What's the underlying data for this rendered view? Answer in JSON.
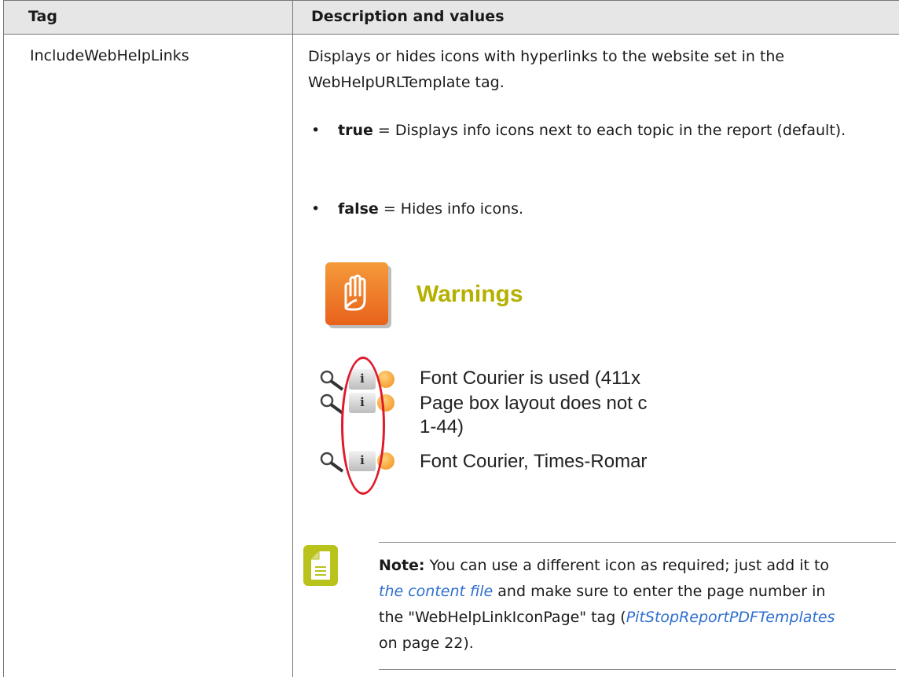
{
  "table": {
    "header": {
      "tag": "Tag",
      "description": "Description and values"
    },
    "row": {
      "tag": "IncludeWebHelpLinks",
      "description": "Displays or hides icons with hyperlinks to the website set in the WebHelpURLTemplate tag.",
      "bullets": [
        {
          "term": "true",
          "text": " = Displays info icons next to each topic in the report (default)."
        },
        {
          "term": "false",
          "text": " = Hides info icons."
        }
      ]
    }
  },
  "illustration": {
    "title": "Warnings",
    "rows": [
      "Font Courier is used (411x",
      "Page box layout does not c",
      "1-44)",
      "Font Courier, Times-Romar"
    ],
    "info_glyph": "i"
  },
  "note": {
    "label": "Note:",
    "text_1": " You can use a different icon as required; just add it to ",
    "link_1": "the content file",
    "text_2": " and make sure to enter the page number in the \"WebHelpLinkIconPage\" tag (",
    "link_2": "PitStopReportPDFTemplates",
    "text_3": " on page 22)."
  },
  "colors": {
    "header_bg": "#e6e6e6",
    "warning_title": "#b5b000",
    "note_icon": "#b9c31b",
    "highlight_ring": "#e0192b",
    "link": "#2f6fcf"
  }
}
